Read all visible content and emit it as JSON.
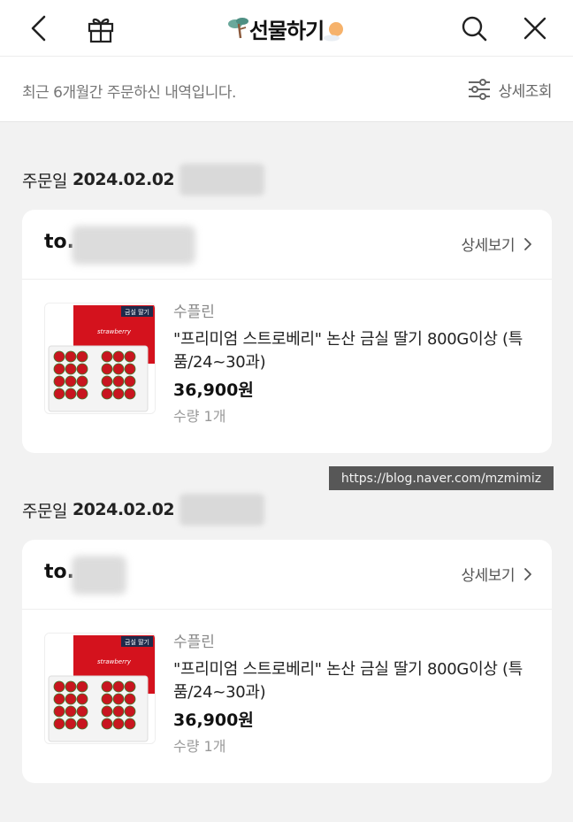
{
  "header": {
    "title": "선물하기",
    "back_icon": "back-arrow-icon",
    "gift_icon": "gift-icon",
    "search_icon": "search-icon",
    "close_icon": "close-icon"
  },
  "subbar": {
    "notice": "최근 6개월간 주문하신 내역입니다.",
    "detail_search_label": "상세조회",
    "filter_icon": "filter-sliders-icon"
  },
  "orders": [
    {
      "date_label": "주문일",
      "date": "2024.02.02",
      "recipient_prefix": "to.",
      "detail_label": "상세보기",
      "product": {
        "brand": "수플린",
        "name": "\"프리미엄 스트로베리\" 논산 금실 딸기 800G이상 (특품/24~30과)",
        "price": "36,900원",
        "quantity": "수량 1개",
        "badge": "금실 딸기",
        "package_text": "strawberry"
      }
    },
    {
      "date_label": "주문일",
      "date": "2024.02.02",
      "recipient_prefix": "to.",
      "detail_label": "상세보기",
      "product": {
        "brand": "수플린",
        "name": "\"프리미엄 스트로베리\" 논산 금실 딸기 800G이상 (특품/24~30과)",
        "price": "36,900원",
        "quantity": "수량 1개",
        "badge": "금실 딸기",
        "package_text": "strawberry"
      }
    }
  ],
  "watermark": "https://blog.naver.com/mzmimiz",
  "colors": {
    "background": "#f2f2f2",
    "card": "#ffffff",
    "package_red": "#d4121d",
    "badge_navy": "#1e2a4a"
  }
}
